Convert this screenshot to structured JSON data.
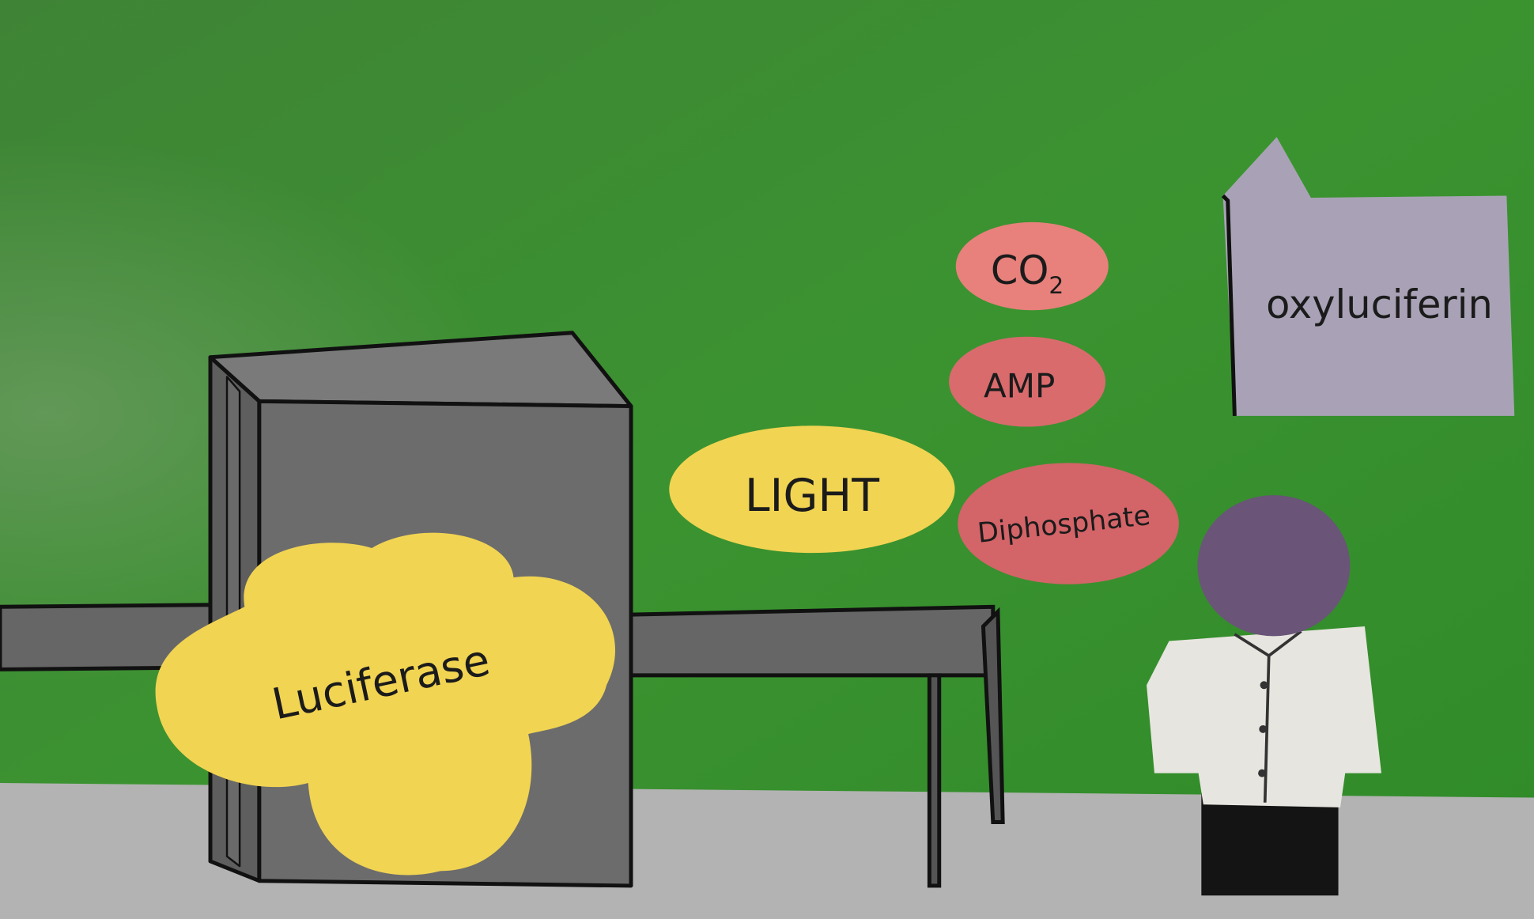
{
  "scene": {
    "labels": {
      "enzyme": "Luciferase",
      "light": "LIGHT",
      "co2_main": "CO",
      "co2_sub": "2",
      "amp": "AMP",
      "diphosphate": "Diphosphate",
      "oxyluciferin": "oxyluciferin"
    },
    "colors": {
      "background": "#3d8c30",
      "floor": "#b3b3b3",
      "machine": "#6c6c6c",
      "yellow": "#f1d452",
      "co2": "#e8807b",
      "amp": "#d96b6d",
      "diphosphate": "#d36468",
      "paper": "#a9a2b6",
      "head": "#6a5478",
      "coat": "#e7e5df"
    }
  }
}
